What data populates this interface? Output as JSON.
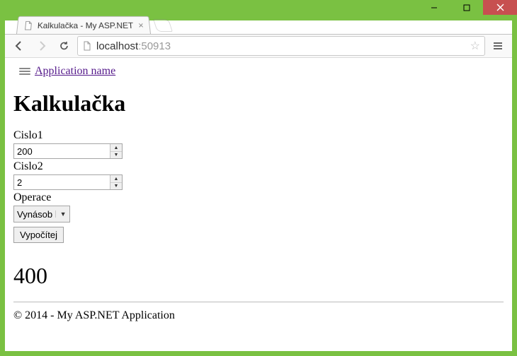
{
  "window": {
    "tab_title": "Kalkulačka - My ASP.NET",
    "url_host": "localhost",
    "url_port": ":50913"
  },
  "page": {
    "brand_link": "Application name",
    "heading": "Kalkulačka",
    "label_cislo1": "Cislo1",
    "value_cislo1": "200",
    "label_cislo2": "Cislo2",
    "value_cislo2": "2",
    "label_operace": "Operace",
    "operace_selected": "Vynásob",
    "submit_label": "Vypočítej",
    "result": "400",
    "footer": "© 2014 - My ASP.NET Application"
  }
}
